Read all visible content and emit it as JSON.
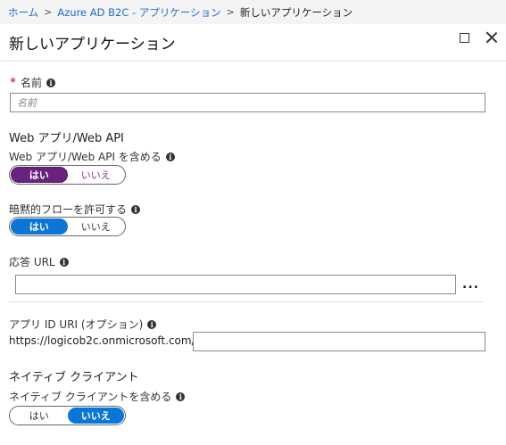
{
  "breadcrumb": {
    "items": [
      "ホーム",
      "Azure AD B2C - アプリケーション"
    ],
    "current": "新しいアプリケーション",
    "separator": ">"
  },
  "header": {
    "title": "新しいアプリケーション"
  },
  "window_controls": {
    "maximize_icon": "square-icon",
    "close_icon": "x-icon"
  },
  "form": {
    "name": {
      "required_mark": "*",
      "label": "名前",
      "info": "i",
      "placeholder": "名前"
    },
    "web_section": {
      "heading": "Web アプリ/Web API",
      "include_web": {
        "label": "Web アプリ/Web API を含める",
        "info": "i",
        "yes": "はい",
        "no": "いいえ",
        "selected": "はい"
      },
      "implicit_flow": {
        "label": "暗黙的フローを許可する",
        "info": "i",
        "yes": "はい",
        "no": "いいえ",
        "selected": "はい"
      },
      "reply_url": {
        "label": "応答 URL",
        "info": "i",
        "value": "",
        "more": "..."
      }
    },
    "app_id_uri": {
      "label": "アプリ ID URI (オプション)",
      "info": "i",
      "prefix": "https://logicob2c.onmicrosoft.com/",
      "value": ""
    },
    "native_section": {
      "heading": "ネイティブ クライアント",
      "include_native": {
        "label": "ネイティブ クライアントを含める",
        "info": "i",
        "yes": "はい",
        "no": "いいえ",
        "selected": "いいえ"
      }
    }
  },
  "colors": {
    "link": "#1a6fc9",
    "toggle_blue": "#0a76d8",
    "toggle_purple": "#6a2180",
    "required": "#cc0000"
  }
}
